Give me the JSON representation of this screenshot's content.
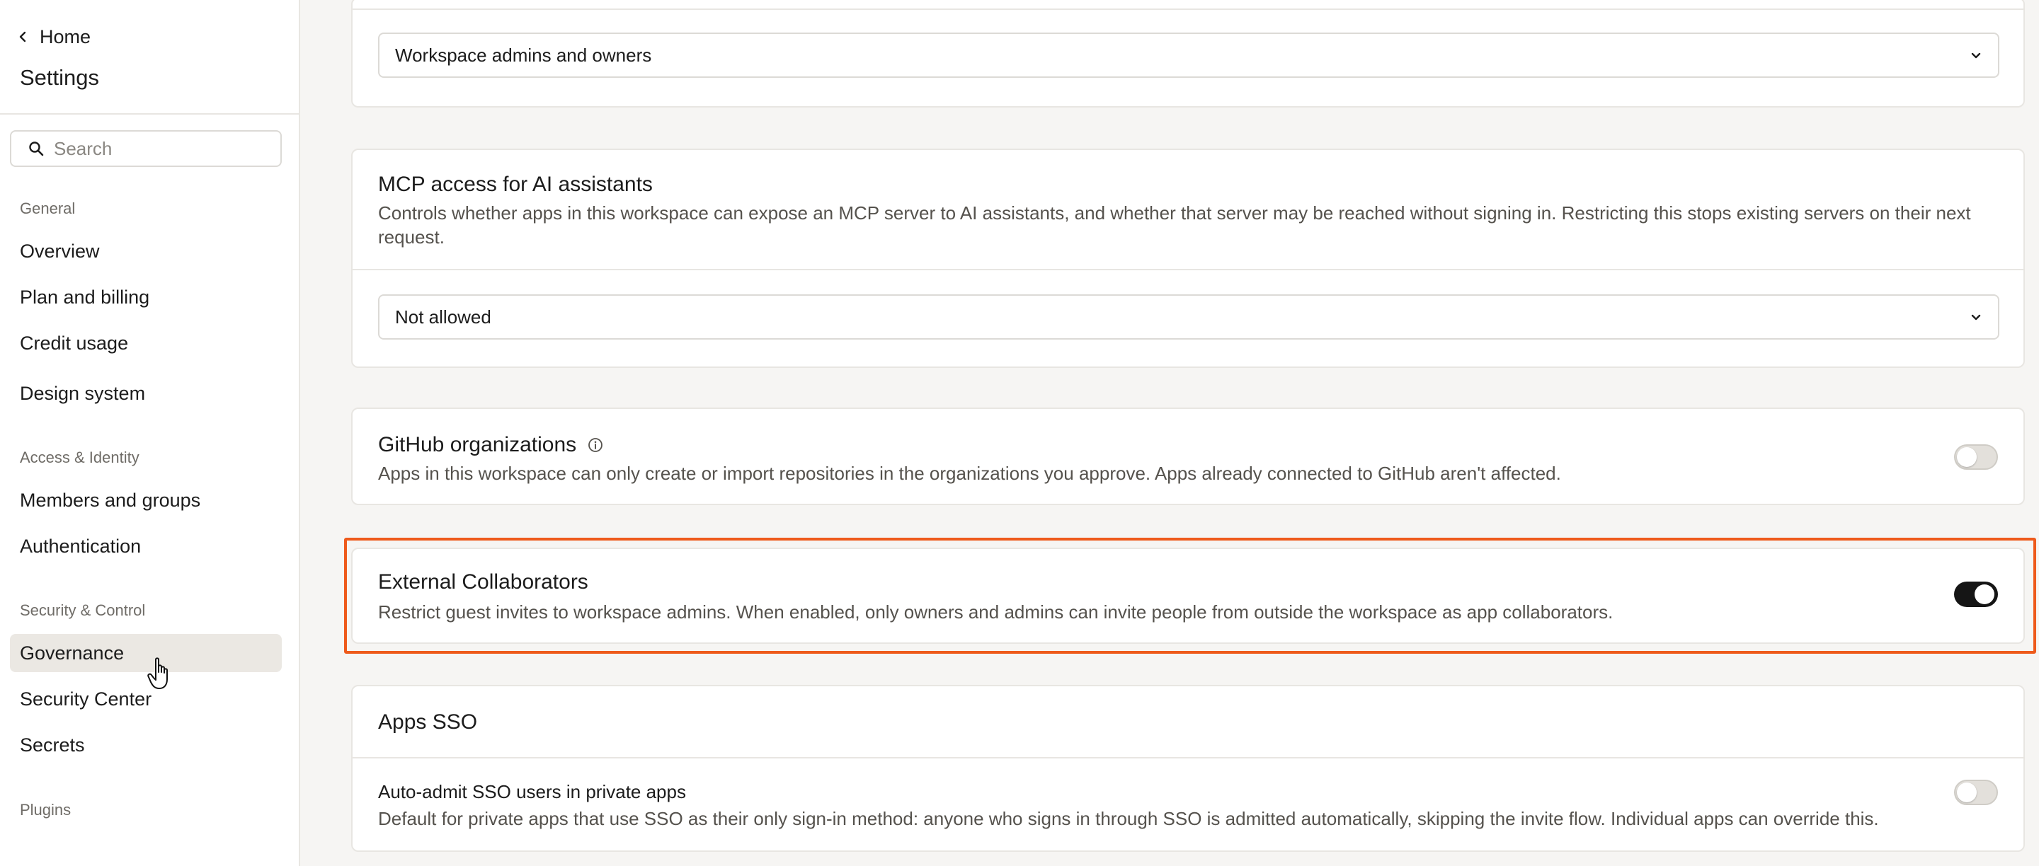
{
  "sidebar": {
    "home_label": "Home",
    "title": "Settings",
    "search_placeholder": "Search",
    "groups": [
      {
        "label": "General",
        "items": [
          "Overview",
          "Plan and billing",
          "Credit usage",
          "Design system"
        ]
      },
      {
        "label": "Access & Identity",
        "items": [
          "Members and groups",
          "Authentication"
        ]
      },
      {
        "label": "Security & Control",
        "items": [
          "Governance",
          "Security Center",
          "Secrets"
        ]
      },
      {
        "label": "Plugins",
        "items": []
      }
    ],
    "active_item": "Governance"
  },
  "main": {
    "top_select": {
      "value": "Workspace admins and owners"
    },
    "mcp": {
      "title": "MCP access for AI assistants",
      "description": "Controls whether apps in this workspace can expose an MCP server to AI assistants, and whether that server may be reached without signing in. Restricting this stops existing servers on their next request.",
      "select_value": "Not allowed"
    },
    "github": {
      "title": "GitHub organizations",
      "description": "Apps in this workspace can only create or import repositories in the organizations you approve. Apps already connected to GitHub aren't affected.",
      "enabled": false
    },
    "external": {
      "title": "External Collaborators",
      "description": "Restrict guest invites to workspace admins. When enabled, only owners and admins can invite people from outside the workspace as app collaborators.",
      "enabled": true
    },
    "apps_sso": {
      "title": "Apps SSO",
      "auto_admit_title": "Auto-admit SSO users in private apps",
      "auto_admit_description": "Default for private apps that use SSO as their only sign-in method: anyone who signs in through SSO is admitted automatically, skipping the invite flow. Individual apps can override this.",
      "auto_admit_enabled": false
    }
  },
  "colors": {
    "highlight": "#ee5a1b",
    "toggle_on": "#151515",
    "toggle_off": "#e3e0db",
    "active_nav": "#ebe8e3",
    "page_bg": "#f6f5f3"
  },
  "icons": [
    "chevron-left-icon",
    "search-icon",
    "chevron-down-icon",
    "info-icon",
    "hand-pointer-icon"
  ]
}
